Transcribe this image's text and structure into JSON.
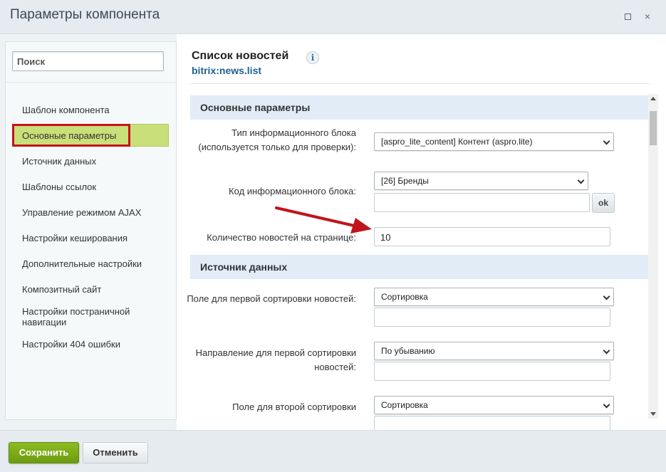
{
  "window": {
    "title": "Параметры компонента",
    "maximize_icon": "maximize-icon",
    "close_icon": "close-icon",
    "close_glyph": "×"
  },
  "sidebar": {
    "search_placeholder": "Поиск",
    "items": [
      {
        "label": "Шаблон компонента"
      },
      {
        "label": "Основные параметры",
        "active": true
      },
      {
        "label": "Источник данных"
      },
      {
        "label": "Шаблоны ссылок"
      },
      {
        "label": "Управление режимом AJAX"
      },
      {
        "label": "Настройки кеширования"
      },
      {
        "label": "Дополнительные настройки"
      },
      {
        "label": "Композитный сайт"
      },
      {
        "label": "Настройки постраничной навигации"
      },
      {
        "label": "Настройки 404 ошибки"
      }
    ]
  },
  "component": {
    "title": "Список новостей",
    "info_icon": "i",
    "code": "bitrix:news.list"
  },
  "sections": {
    "main": {
      "title": "Основные параметры",
      "iblock_type_label": "Тип информационного блока (используется только для проверки):",
      "iblock_type_value": "[aspro_lite_content] Контент (aspro.lite)",
      "iblock_code_label": "Код информационного блока:",
      "iblock_code_value": "[26] Бренды",
      "iblock_code_text": "",
      "ok_label": "ok",
      "news_count_label": "Количество новостей на странице:",
      "news_count_value": "10"
    },
    "data_source": {
      "title": "Источник данных",
      "sort_by1_label": "Поле для первой сортировки новостей:",
      "sort_by1_value": "Сортировка",
      "sort_order1_label": "Направление для первой сортировки новостей:",
      "sort_order1_value": "По убыванию",
      "sort_by2_label": "Поле для второй сортировки",
      "sort_by2_value": "Сортировка"
    }
  },
  "footer": {
    "save_label": "Сохранить",
    "cancel_label": "Отменить"
  },
  "colors": {
    "active_item": "#c9df79",
    "highlight_box": "#c3141d",
    "annotation_arrow": "#c0141c",
    "save_button": "#7aab17",
    "section_header": "#e1ecf6",
    "link": "#1e5f95"
  }
}
